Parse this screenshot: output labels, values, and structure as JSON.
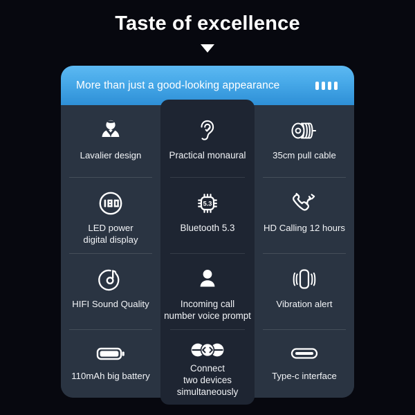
{
  "page": {
    "title": "Taste of excellence",
    "caret_icon": "triangle-down-icon",
    "background_color": "#07080f"
  },
  "card": {
    "header": {
      "title": "More than just a good-looking appearance",
      "accent_color": "#46a8e8",
      "signal_icon": "signal-bars-icon",
      "signal_bar_count": 4
    },
    "surface_color": "#2a3442",
    "highlight_column_color": "#1e2532",
    "features": [
      {
        "icon": "person-in-suit-icon",
        "label": "Lavalier design"
      },
      {
        "icon": "ear-icon",
        "label": "Practical monaural"
      },
      {
        "icon": "coiled-cable-icon",
        "label": "35cm pull cable"
      },
      {
        "icon": "led-battery-percent-icon",
        "label": "LED power\ndigital display",
        "icon_value": "100"
      },
      {
        "icon": "bluetooth-chip-icon",
        "label": "Bluetooth 5.3",
        "icon_value": "5.3"
      },
      {
        "icon": "phone-call-arrow-icon",
        "label": "HD Calling 12 hours"
      },
      {
        "icon": "music-note-circle-icon",
        "label": "HIFI Sound Quality"
      },
      {
        "icon": "person-icon",
        "label": "Incoming call\nnumber voice prompt"
      },
      {
        "icon": "phone-vibration-icon",
        "label": "Vibration alert"
      },
      {
        "icon": "battery-icon",
        "label": "110mAh big battery"
      },
      {
        "icon": "two-devices-connect-icon",
        "label": "Connect\ntwo devices\nsimultaneously"
      },
      {
        "icon": "usb-type-c-port-icon",
        "label": "Type-c interface"
      }
    ]
  }
}
